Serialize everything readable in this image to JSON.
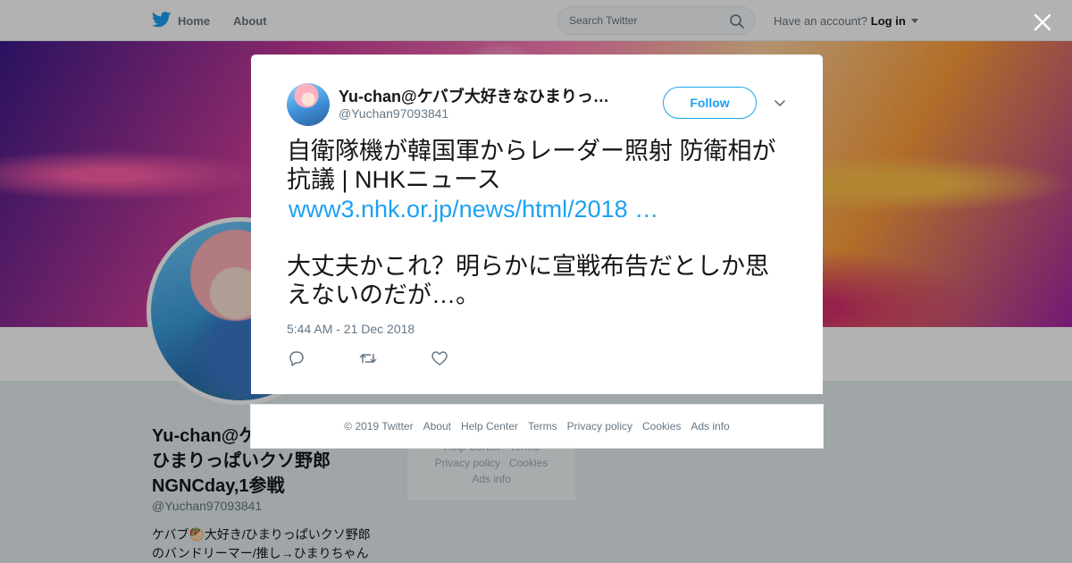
{
  "topbar": {
    "home_label": "Home",
    "about_label": "About",
    "search_placeholder": "Search Twitter",
    "account_prompt": "Have an account?",
    "login_label": "Log in"
  },
  "profile": {
    "name_line1": "Yu-chan@ケ",
    "name_line2": "ひまりっぱいクソ野郎",
    "name_line3": "NGNCday,1参戦",
    "handle": "@Yuchan97093841",
    "bio_line1": "ケバブ🥙大好き/ひまりっぱいクソ野郎",
    "bio_line2": "のバンドリーマー/推し→ひまりちゃん"
  },
  "side_footer": {
    "row1": [
      "Help Center",
      "Terms"
    ],
    "row2": [
      "Privacy policy",
      "Cookies"
    ],
    "row3": [
      "Ads info"
    ]
  },
  "tweet": {
    "author_name": "Yu-chan@ケバブ大好きなひまりっ…",
    "author_handle": "@Yuchan97093841",
    "follow_label": "Follow",
    "text_line1": "自衛隊機が韓国軍からレーダー照射 防衛相が",
    "text_line2": "抗議 | NHKニュース",
    "link_text": "www3.nhk.or.jp/news/html/2018 …",
    "text2_line1": "大丈夫かこれ？明らかに宣戦布告だとしか思",
    "text2_line2": "えないのだが…。",
    "timestamp": "5:44 AM - 21 Dec 2018"
  },
  "footer": {
    "copyright": "© 2019 Twitter",
    "links": [
      "About",
      "Help Center",
      "Terms",
      "Privacy policy",
      "Cookies",
      "Ads info"
    ]
  },
  "colors": {
    "accent": "#1da1f2",
    "text": "#14171a",
    "muted": "#657786"
  },
  "icons": [
    "twitter-bird-icon",
    "search-icon",
    "close-icon",
    "chevron-down-icon",
    "reply-icon",
    "retweet-icon",
    "like-icon"
  ]
}
